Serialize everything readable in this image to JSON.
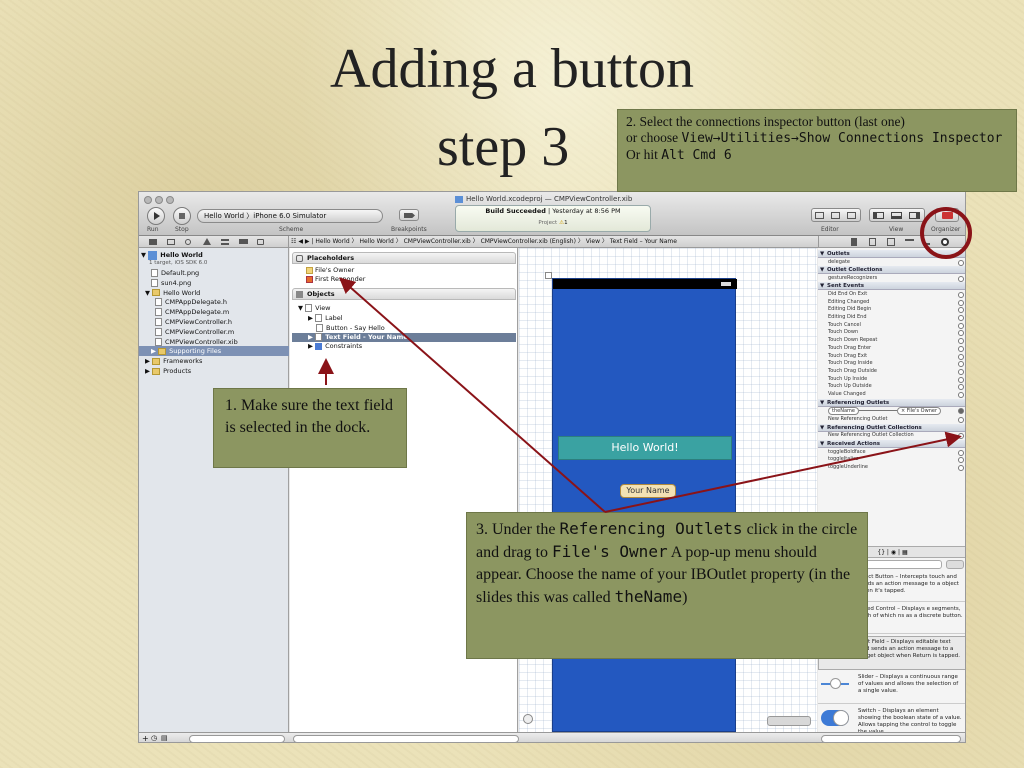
{
  "slide": {
    "title_line1": "Adding a button",
    "title_line2": "step 3"
  },
  "note2": {
    "line1": "2.      Select the connections inspector button (last one)",
    "line2_pre": " or choose ",
    "line2_mono": "View→Utilities→Show Connections Inspector",
    "line3_pre": "Or hit ",
    "line3_mono": "Alt Cmd 6"
  },
  "note1": {
    "text": "1.  Make sure the text field is selected in the dock."
  },
  "note3": {
    "pre": "3.  Under the ",
    "mono1": "Referencing Outlets",
    "mid": " click in the circle and drag to ",
    "mono2": "File's Owner",
    "post": " A pop-up menu should appear.  Choose the name of your IBOutlet property (in the slides this was called ",
    "mono3": "theName",
    "end": ")"
  },
  "xcode": {
    "window_title": "Hello World.xcodeproj — CMPViewController.xib",
    "run": "Run",
    "stop": "Stop",
    "scheme": "Scheme",
    "breakpoints": "Breakpoints",
    "scheme_value": "Hello World 〉iPhone 6.0 Simulator",
    "build_status": "Build Succeeded",
    "build_time": "Yesterday at 8:56 PM",
    "project_label": "Project",
    "warn_count": "1",
    "editor": "Editor",
    "view": "View",
    "organizer": "Organizer",
    "jumpbar": [
      "Hello World",
      "Hello World",
      "CMPViewController.xib",
      "CMPViewController.xib (English)",
      "View",
      "Text Field – Your Name"
    ],
    "navigator": [
      {
        "label": "Hello World",
        "kind": "project"
      },
      {
        "label": "1 target, iOS SDK 6.0",
        "kind": "sub"
      },
      {
        "label": "Default.png",
        "kind": "file"
      },
      {
        "label": "sun4.png",
        "kind": "file"
      },
      {
        "label": "Hello World",
        "kind": "folder"
      },
      {
        "label": "CMPAppDelegate.h",
        "kind": "file"
      },
      {
        "label": "CMPAppDelegate.m",
        "kind": "file"
      },
      {
        "label": "CMPViewController.h",
        "kind": "file"
      },
      {
        "label": "CMPViewController.m",
        "kind": "file"
      },
      {
        "label": "CMPViewController.xib",
        "kind": "file"
      },
      {
        "label": "Supporting Files",
        "kind": "folder-selected"
      },
      {
        "label": "Frameworks",
        "kind": "folder"
      },
      {
        "label": "Products",
        "kind": "folder"
      }
    ],
    "dock": {
      "placeholders_title": "Placeholders",
      "files_owner": "File's Owner",
      "first_responder": "First Responder",
      "objects_title": "Objects",
      "view": "View",
      "label": "Label",
      "button": "Button - Say Hello",
      "text_field": "Text Field - Your Name",
      "constraints": "Constraints"
    },
    "canvas": {
      "hello_label": "Hello World!",
      "textfield_placeholder": "Your Name"
    },
    "inspector": {
      "outlets": "Outlets",
      "delegate": "delegate",
      "outlet_collections": "Outlet Collections",
      "gesture": "gestureRecognizers",
      "sent_events": "Sent Events",
      "events": [
        "Did End On Exit",
        "Editing Changed",
        "Editing Did Begin",
        "Editing Did End",
        "Touch Cancel",
        "Touch Down",
        "Touch Down Repeat",
        "Touch Drag Enter",
        "Touch Drag Exit",
        "Touch Drag Inside",
        "Touch Drag Outside",
        "Touch Up Inside",
        "Touch Up Outside",
        "Value Changed"
      ],
      "referencing_outlets": "Referencing Outlets",
      "the_name": "theName",
      "files_owner_conn": "× File's Owner",
      "new_ref_outlet": "New Referencing Outlet",
      "ref_outlet_collections": "Referencing Outlet Collections",
      "new_ref_collection": "New Referencing Outlet Collection",
      "received_actions": "Received Actions",
      "actions": [
        "toggleBoldface",
        "toggleItalics",
        "toggleUnderline"
      ],
      "library": [
        {
          "title": "Rounded Rect Button",
          "desc": "l Rect Button – Intercepts touch and sends an action message to a object when it's tapped."
        },
        {
          "title": "Segmented Control",
          "desc": "ented Control – Displays e segments, each of which ns as a discrete button."
        },
        {
          "title": "Text Field",
          "desc": "Text Field – Displays editable text and sends an action message to a target object when Return is tapped.",
          "icon": "Text"
        },
        {
          "title": "Slider",
          "desc": "Slider – Displays a continuous range of values and allows the selection of a single value."
        },
        {
          "title": "Switch",
          "desc": "Switch – Displays an element showing the boolean state of a value. Allows tapping the control to toggle the value."
        }
      ]
    }
  },
  "colors": {
    "note_bg": "#8c9661",
    "arrow": "#8a1318",
    "phone_blue": "#2358c0"
  }
}
